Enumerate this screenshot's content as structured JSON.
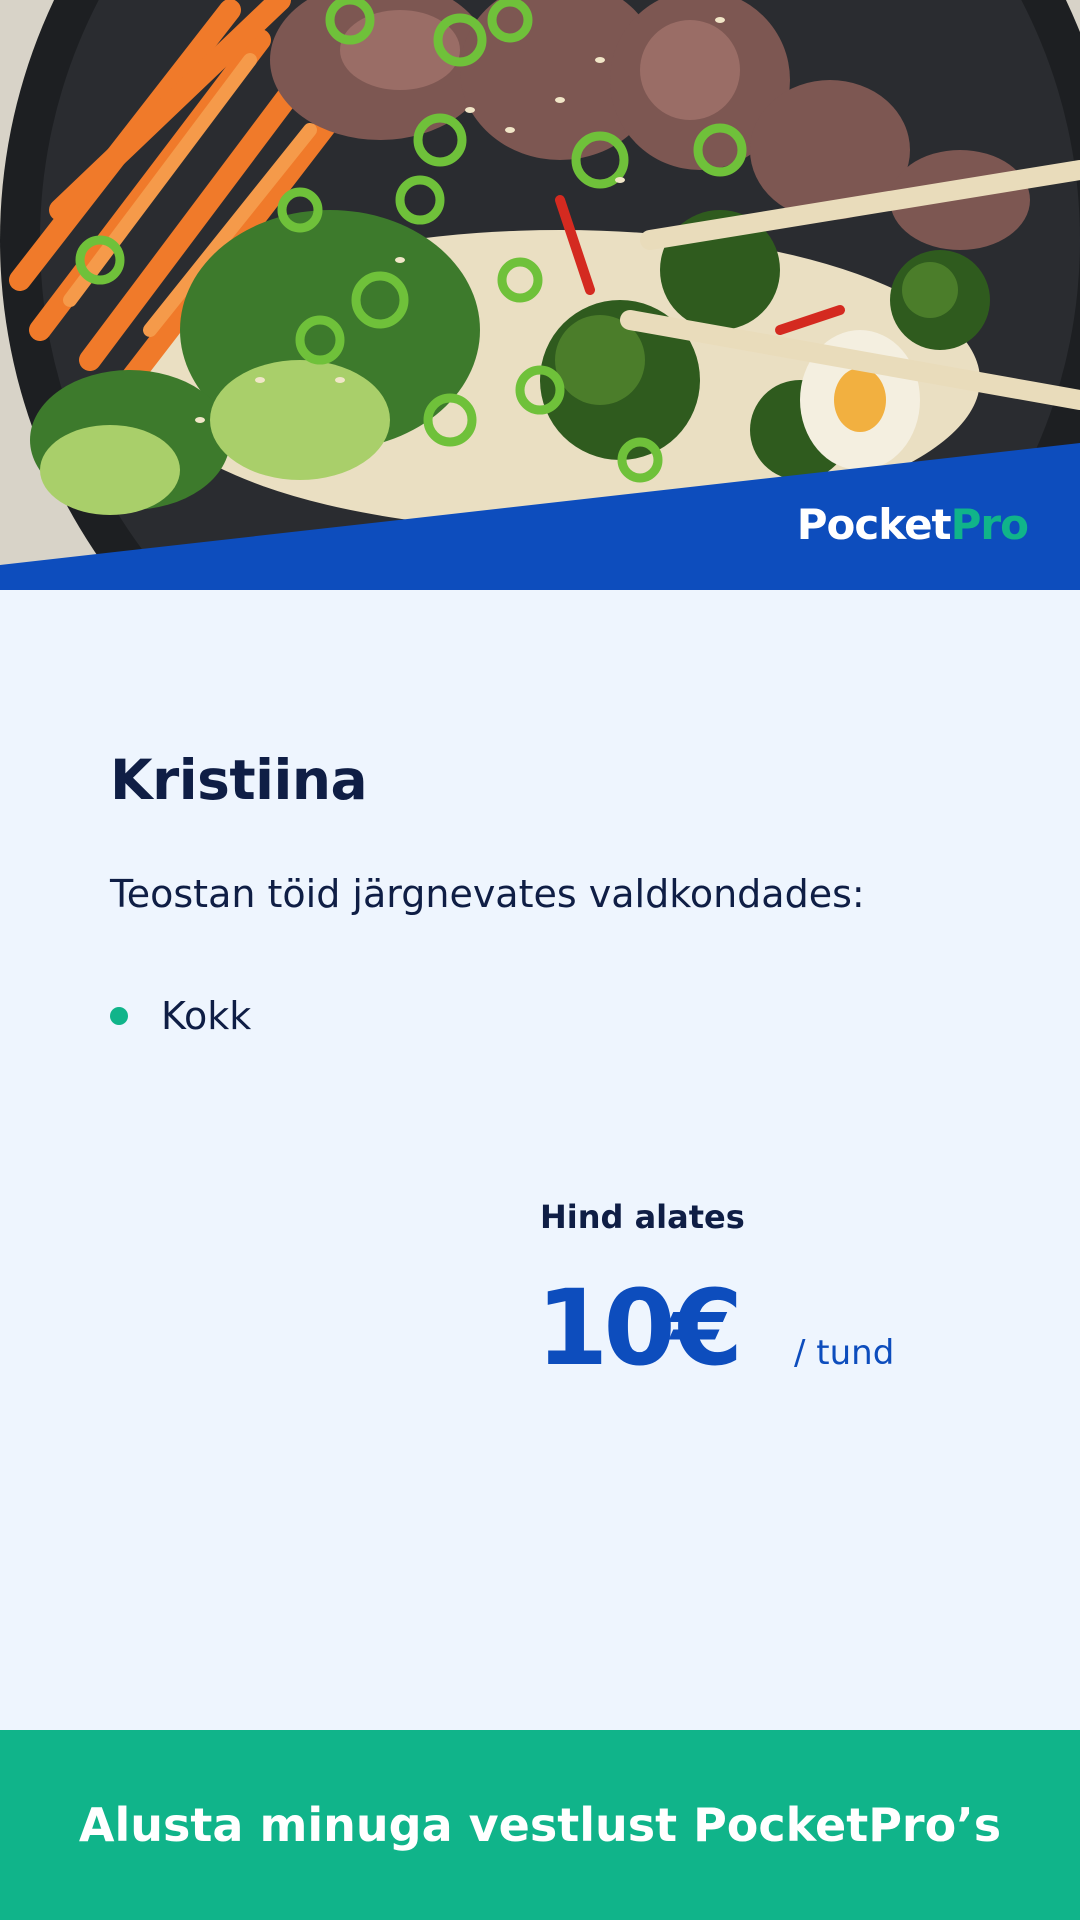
{
  "brand": {
    "name_part1": "Pocket",
    "name_part2": "Pro"
  },
  "profile": {
    "name": "Kristiina",
    "intro": "Teostan töid järgnevates valdkondades:",
    "skills": [
      "Kokk"
    ]
  },
  "pricing": {
    "title": "Hind alates",
    "amount": "10€",
    "unit": "/ tund"
  },
  "cta": {
    "label": "Alusta minuga vestlust PocketPro’s"
  },
  "colors": {
    "brand_blue": "#0d4dbd",
    "brand_green": "#10b48a",
    "page_background": "#eef5fe",
    "text_dark": "#0f1e45"
  }
}
